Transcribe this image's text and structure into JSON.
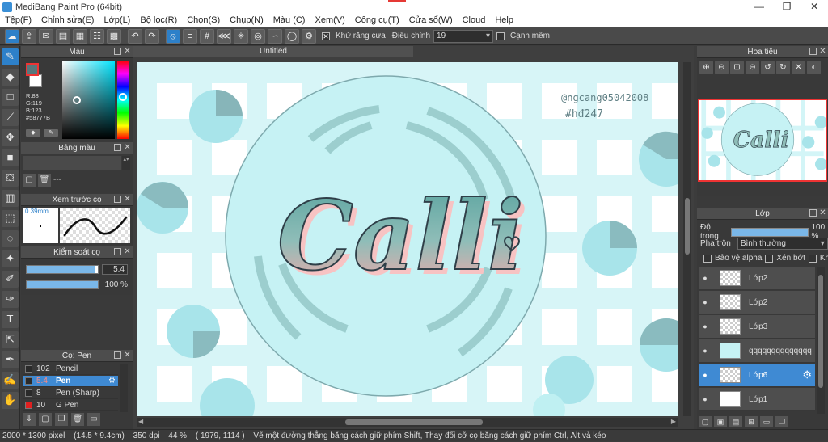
{
  "window": {
    "title": "MediBang Paint Pro (64bit)",
    "controls": [
      "—",
      "❐",
      "✕"
    ]
  },
  "menu": [
    "Tệp(F)",
    "Chỉnh sửa(E)",
    "Lớp(L)",
    "Bộ lọc(R)",
    "Chọn(S)",
    "Chụp(N)",
    "Màu (C)",
    "Xem(V)",
    "Công cụ(T)",
    "Cửa sổ(W)",
    "Cloud",
    "Help"
  ],
  "toolbar": {
    "antialias_label": "Khử răng cưa",
    "adjust_label": "Điều chỉnh",
    "adjust_value": "19",
    "edge_label": "Cạnh mềm"
  },
  "color_panel": {
    "title": "Màu",
    "fg_color": "#58777B",
    "rgb_text": [
      "R:88",
      "G:119",
      "B:123",
      "#58777B"
    ]
  },
  "palette_panel": {
    "title": "Bảng màu",
    "dash": "---"
  },
  "preview_panel": {
    "title": "Xem trước cọ",
    "size": "0.39mm"
  },
  "brush_control": {
    "title": "Kiểm soát cọ",
    "size_value": "5.4",
    "size_fill": 0.95,
    "opacity_value": "100 %",
    "opacity_fill": 1.0
  },
  "brush_list": {
    "title": "Cọ: Pen",
    "items": [
      {
        "num": "102",
        "name": "Pencil",
        "color": "#2a2a2a",
        "selected": false
      },
      {
        "num": "5.4",
        "name": "Pen",
        "color": "#2a2a2a",
        "selected": true
      },
      {
        "num": "8",
        "name": "Pen (Sharp)",
        "color": "#2a2a2a",
        "selected": false
      },
      {
        "num": "10",
        "name": "G Pen",
        "color": "#e02020",
        "selected": false
      }
    ]
  },
  "document": {
    "tab": "Untitled",
    "calli_text": "Calli",
    "watermark_line1": "@ngcang05042008",
    "watermark_line2": "#hđ247"
  },
  "navigator": {
    "title": "Hoa tiêu"
  },
  "layers": {
    "title": "Lớp",
    "opacity_label": "Độ trong",
    "opacity_value": "100 %",
    "blend_label": "Pha trộn",
    "blend_value": "Bình thường",
    "protect_alpha": "Bảo vệ alpha",
    "clip": "Xén bớt",
    "lock": "Khóa",
    "items": [
      {
        "name": "Lớp2",
        "selected": false
      },
      {
        "name": "Lớp2",
        "selected": false
      },
      {
        "name": "Lớp3",
        "selected": false
      },
      {
        "name": "qqqqqqqqqqqqqq",
        "selected": false
      },
      {
        "name": "Lớp6",
        "selected": true
      },
      {
        "name": "Lớp1",
        "selected": false
      }
    ]
  },
  "status": {
    "size": "2000 * 1300 pixel",
    "physical": "(14.5 * 9.4cm)",
    "dpi": "350 dpi",
    "zoom": "44 %",
    "coords": "( 1979, 1114 )",
    "hint": "Vẽ một đường thẳng bằng cách giữ phím Shift, Thay đổi cỡ cọ bằng cách giữ phím Ctrl, Alt và kéo"
  },
  "colors": {
    "accent": "#2d80c9",
    "canvas_bg": "#ffffff",
    "circle_fill": "#c6f2f4",
    "dot_teal": "#9fdde4",
    "dot_dark": "#7ea9ad",
    "text_dark": "#2f3f48",
    "text_gradient_top": "#58a39e",
    "text_gradient_bottom": "#f6a8a8"
  }
}
